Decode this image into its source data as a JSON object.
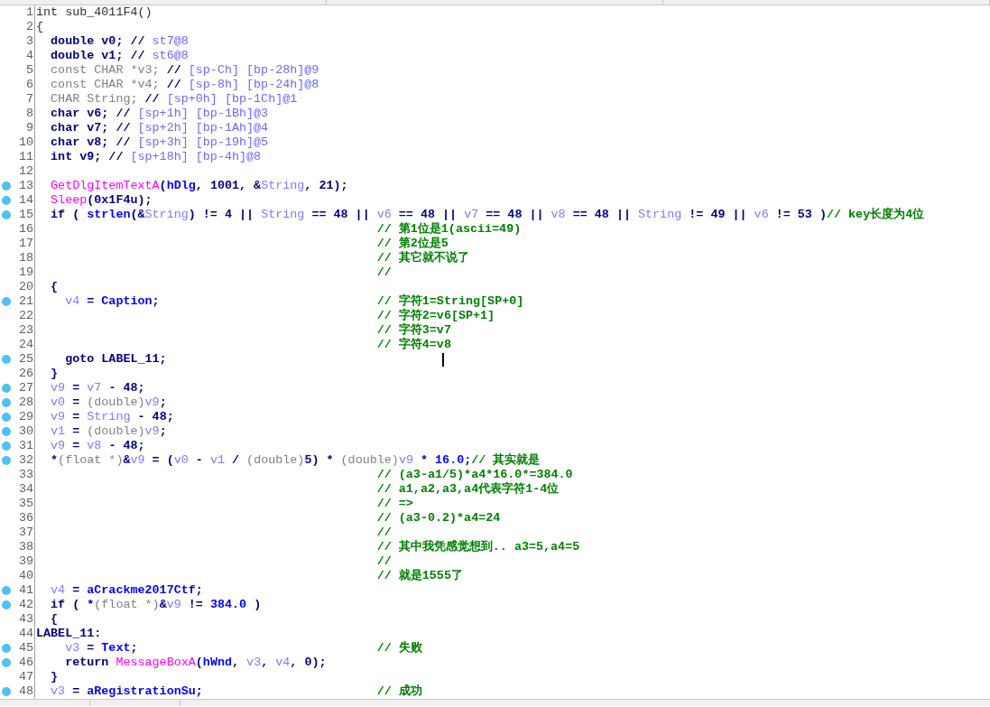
{
  "lines": [
    {
      "number": "1",
      "dot": false,
      "cursor": false,
      "code": [
        {
          "kind": "plain",
          "text": "int sub_4011F4()"
        }
      ]
    },
    {
      "number": "2",
      "dot": false,
      "cursor": false,
      "code": [
        {
          "kind": "plain",
          "text": "{"
        }
      ]
    },
    {
      "number": "3",
      "dot": false,
      "cursor": false,
      "code": [
        {
          "kind": "punct",
          "text": "  double v0; // "
        },
        {
          "kind": "stack",
          "text": "st7@8"
        }
      ]
    },
    {
      "number": "4",
      "dot": false,
      "cursor": false,
      "code": [
        {
          "kind": "punct",
          "text": "  double v1; // "
        },
        {
          "kind": "stack",
          "text": "st6@8"
        }
      ]
    },
    {
      "number": "5",
      "dot": false,
      "cursor": false,
      "code": [
        {
          "kind": "type",
          "text": "  const CHAR *v3; "
        },
        {
          "kind": "punct",
          "text": "// "
        },
        {
          "kind": "stack",
          "text": "[sp-Ch] [bp-28h]@9"
        }
      ]
    },
    {
      "number": "6",
      "dot": false,
      "cursor": false,
      "code": [
        {
          "kind": "type",
          "text": "  const CHAR *v4; "
        },
        {
          "kind": "punct",
          "text": "// "
        },
        {
          "kind": "stack",
          "text": "[sp-8h] [bp-24h]@8"
        }
      ]
    },
    {
      "number": "7",
      "dot": false,
      "cursor": false,
      "code": [
        {
          "kind": "type",
          "text": "  CHAR String; "
        },
        {
          "kind": "punct",
          "text": "// "
        },
        {
          "kind": "stack",
          "text": "[sp+0h] [bp-1Ch]@1"
        }
      ]
    },
    {
      "number": "8",
      "dot": false,
      "cursor": false,
      "code": [
        {
          "kind": "punct",
          "text": "  char v6; // "
        },
        {
          "kind": "stack",
          "text": "[sp+1h] [bp-1Bh]@3"
        }
      ]
    },
    {
      "number": "9",
      "dot": false,
      "cursor": false,
      "code": [
        {
          "kind": "punct",
          "text": "  char v7; // "
        },
        {
          "kind": "stack",
          "text": "[sp+2h] [bp-1Ah]@4"
        }
      ]
    },
    {
      "number": "10",
      "dot": false,
      "cursor": false,
      "code": [
        {
          "kind": "punct",
          "text": "  char v8; // "
        },
        {
          "kind": "stack",
          "text": "[sp+3h] [bp-19h]@5"
        }
      ]
    },
    {
      "number": "11",
      "dot": false,
      "cursor": false,
      "code": [
        {
          "kind": "punct",
          "text": "  int v9; // "
        },
        {
          "kind": "stack",
          "text": "[sp+18h] [bp-4h]@8"
        }
      ]
    },
    {
      "number": "12",
      "dot": false,
      "cursor": false
    },
    {
      "number": "13",
      "dot": true,
      "cursor": false,
      "code": [
        {
          "kind": "func",
          "text": "  GetDlgItemTextA"
        },
        {
          "kind": "punct",
          "text": "("
        },
        {
          "kind": "name",
          "text": "hDlg"
        },
        {
          "kind": "punct",
          "text": ", 1001, &"
        },
        {
          "kind": "var",
          "text": "String"
        },
        {
          "kind": "punct",
          "text": ", 21);"
        }
      ]
    },
    {
      "number": "14",
      "dot": true,
      "cursor": false,
      "code": [
        {
          "kind": "func",
          "text": "  Sleep"
        },
        {
          "kind": "punct",
          "text": "(0x1F4u);"
        }
      ]
    },
    {
      "number": "15",
      "dot": true,
      "cursor": false,
      "code": [
        {
          "kind": "punct",
          "text": "  if ( "
        },
        {
          "kind": "name",
          "text": "strlen"
        },
        {
          "kind": "punct",
          "text": "(&"
        },
        {
          "kind": "var",
          "text": "String"
        },
        {
          "kind": "punct",
          "text": ") != 4 || "
        },
        {
          "kind": "var",
          "text": "String"
        },
        {
          "kind": "punct",
          "text": " == 48 || "
        },
        {
          "kind": "var",
          "text": "v6"
        },
        {
          "kind": "punct",
          "text": " == 48 || "
        },
        {
          "kind": "var",
          "text": "v7"
        },
        {
          "kind": "punct",
          "text": " == 48 || "
        },
        {
          "kind": "var",
          "text": "v8"
        },
        {
          "kind": "punct",
          "text": " == 48 || "
        },
        {
          "kind": "var",
          "text": "String"
        },
        {
          "kind": "punct",
          "text": " != 49 || "
        },
        {
          "kind": "var",
          "text": "v6"
        },
        {
          "kind": "punct",
          "text": " != 53 )"
        }
      ],
      "comment": "// key长度为4位"
    },
    {
      "number": "16",
      "dot": false,
      "cursor": false,
      "comment": "// 第1位是1(ascii=49)"
    },
    {
      "number": "17",
      "dot": false,
      "cursor": false,
      "comment": "// 第2位是5"
    },
    {
      "number": "18",
      "dot": false,
      "cursor": false,
      "comment": "// 其它就不说了"
    },
    {
      "number": "19",
      "dot": false,
      "cursor": false,
      "comment": "//"
    },
    {
      "number": "20",
      "dot": false,
      "cursor": false,
      "code": [
        {
          "kind": "punct",
          "text": "  {"
        }
      ]
    },
    {
      "number": "21",
      "dot": true,
      "cursor": false,
      "code": [
        {
          "kind": "var",
          "text": "    v4"
        },
        {
          "kind": "punct",
          "text": " = "
        },
        {
          "kind": "name",
          "text": "Caption"
        },
        {
          "kind": "punct",
          "text": ";"
        }
      ],
      "comment": "// 字符1=String[SP+0]"
    },
    {
      "number": "22",
      "dot": false,
      "cursor": false,
      "comment": "// 字符2=v6[SP+1]"
    },
    {
      "number": "23",
      "dot": false,
      "cursor": false,
      "comment": "// 字符3=v7"
    },
    {
      "number": "24",
      "dot": false,
      "cursor": false,
      "comment": "// 字符4=v8"
    },
    {
      "number": "25",
      "dot": true,
      "cursor": true,
      "code": [
        {
          "kind": "punct",
          "text": "    goto LABEL_11;"
        }
      ]
    },
    {
      "number": "26",
      "dot": false,
      "cursor": false,
      "code": [
        {
          "kind": "punct",
          "text": "  }"
        }
      ]
    },
    {
      "number": "27",
      "dot": true,
      "cursor": false,
      "code": [
        {
          "kind": "var",
          "text": "  v9"
        },
        {
          "kind": "punct",
          "text": " = "
        },
        {
          "kind": "var",
          "text": "v7"
        },
        {
          "kind": "punct",
          "text": " - 48;"
        }
      ]
    },
    {
      "number": "28",
      "dot": true,
      "cursor": false,
      "code": [
        {
          "kind": "var",
          "text": "  v0"
        },
        {
          "kind": "punct",
          "text": " = "
        },
        {
          "kind": "type",
          "text": "(double)"
        },
        {
          "kind": "var",
          "text": "v9"
        },
        {
          "kind": "punct",
          "text": ";"
        }
      ]
    },
    {
      "number": "29",
      "dot": true,
      "cursor": false,
      "code": [
        {
          "kind": "var",
          "text": "  v9"
        },
        {
          "kind": "punct",
          "text": " = "
        },
        {
          "kind": "var",
          "text": "String"
        },
        {
          "kind": "punct",
          "text": " - 48;"
        }
      ]
    },
    {
      "number": "30",
      "dot": true,
      "cursor": false,
      "code": [
        {
          "kind": "var",
          "text": "  v1"
        },
        {
          "kind": "punct",
          "text": " = "
        },
        {
          "kind": "type",
          "text": "(double)"
        },
        {
          "kind": "var",
          "text": "v9"
        },
        {
          "kind": "punct",
          "text": ";"
        }
      ]
    },
    {
      "number": "31",
      "dot": true,
      "cursor": false,
      "code": [
        {
          "kind": "var",
          "text": "  v9"
        },
        {
          "kind": "punct",
          "text": " = "
        },
        {
          "kind": "var",
          "text": "v8"
        },
        {
          "kind": "punct",
          "text": " - 48;"
        }
      ]
    },
    {
      "number": "32",
      "dot": true,
      "cursor": false,
      "code": [
        {
          "kind": "punct",
          "text": "  *"
        },
        {
          "kind": "type",
          "text": "(float *)"
        },
        {
          "kind": "punct",
          "text": "&"
        },
        {
          "kind": "var",
          "text": "v9"
        },
        {
          "kind": "punct",
          "text": " = ("
        },
        {
          "kind": "var",
          "text": "v0"
        },
        {
          "kind": "punct",
          "text": " - "
        },
        {
          "kind": "var",
          "text": "v1"
        },
        {
          "kind": "punct",
          "text": " / "
        },
        {
          "kind": "type",
          "text": "(double)"
        },
        {
          "kind": "punct",
          "text": "5) * "
        },
        {
          "kind": "type",
          "text": "(double)"
        },
        {
          "kind": "var",
          "text": "v9"
        },
        {
          "kind": "punct",
          "text": " * "
        },
        {
          "kind": "name",
          "text": "16.0"
        },
        {
          "kind": "punct",
          "text": ";"
        }
      ],
      "comment": "// 其实就是"
    },
    {
      "number": "33",
      "dot": false,
      "cursor": false,
      "comment": "// (a3-a1/5)*a4*16.0*=384.0"
    },
    {
      "number": "34",
      "dot": false,
      "cursor": false,
      "comment": "// a1,a2,a3,a4代表字符1-4位"
    },
    {
      "number": "35",
      "dot": false,
      "cursor": false,
      "comment": "// =>"
    },
    {
      "number": "36",
      "dot": false,
      "cursor": false,
      "comment": "// (a3-0.2)*a4=24"
    },
    {
      "number": "37",
      "dot": false,
      "cursor": false,
      "comment": "//"
    },
    {
      "number": "38",
      "dot": false,
      "cursor": false,
      "comment": "// 其中我凭感觉想到.. a3=5,a4=5"
    },
    {
      "number": "39",
      "dot": false,
      "cursor": false,
      "comment": "//"
    },
    {
      "number": "40",
      "dot": false,
      "cursor": false,
      "comment": "// 就是1555了"
    },
    {
      "number": "41",
      "dot": true,
      "cursor": false,
      "code": [
        {
          "kind": "var",
          "text": "  v4"
        },
        {
          "kind": "punct",
          "text": " = "
        },
        {
          "kind": "name",
          "text": "aCrackme2017Ctf"
        },
        {
          "kind": "punct",
          "text": ";"
        }
      ]
    },
    {
      "number": "42",
      "dot": true,
      "cursor": false,
      "code": [
        {
          "kind": "punct",
          "text": "  if ( *"
        },
        {
          "kind": "type",
          "text": "(float *)"
        },
        {
          "kind": "punct",
          "text": "&"
        },
        {
          "kind": "var",
          "text": "v9"
        },
        {
          "kind": "punct",
          "text": " != "
        },
        {
          "kind": "name",
          "text": "384.0"
        },
        {
          "kind": "punct",
          "text": " )"
        }
      ]
    },
    {
      "number": "43",
      "dot": false,
      "cursor": false,
      "code": [
        {
          "kind": "punct",
          "text": "  {"
        }
      ]
    },
    {
      "number": "44",
      "dot": false,
      "cursor": false,
      "code": [
        {
          "kind": "punct",
          "text": "LABEL_11:"
        }
      ]
    },
    {
      "number": "45",
      "dot": true,
      "cursor": false,
      "code": [
        {
          "kind": "var",
          "text": "    v3"
        },
        {
          "kind": "punct",
          "text": " = "
        },
        {
          "kind": "name",
          "text": "Text"
        },
        {
          "kind": "punct",
          "text": ";"
        }
      ],
      "comment": "// 失败"
    },
    {
      "number": "46",
      "dot": true,
      "cursor": false,
      "code": [
        {
          "kind": "punct",
          "text": "    return "
        },
        {
          "kind": "func",
          "text": "MessageBoxA"
        },
        {
          "kind": "punct",
          "text": "("
        },
        {
          "kind": "name",
          "text": "hWnd"
        },
        {
          "kind": "punct",
          "text": ", "
        },
        {
          "kind": "var",
          "text": "v3"
        },
        {
          "kind": "punct",
          "text": ", "
        },
        {
          "kind": "var",
          "text": "v4"
        },
        {
          "kind": "punct",
          "text": ", 0);"
        }
      ]
    },
    {
      "number": "47",
      "dot": false,
      "cursor": false,
      "code": [
        {
          "kind": "punct",
          "text": "  }"
        }
      ]
    },
    {
      "number": "48",
      "dot": true,
      "cursor": false,
      "code": [
        {
          "kind": "var",
          "text": "  v3"
        },
        {
          "kind": "punct",
          "text": " = "
        },
        {
          "kind": "name",
          "text": "aRegistrationSu"
        },
        {
          "kind": "punct",
          "text": ";"
        }
      ],
      "comment": "// 成功"
    }
  ]
}
